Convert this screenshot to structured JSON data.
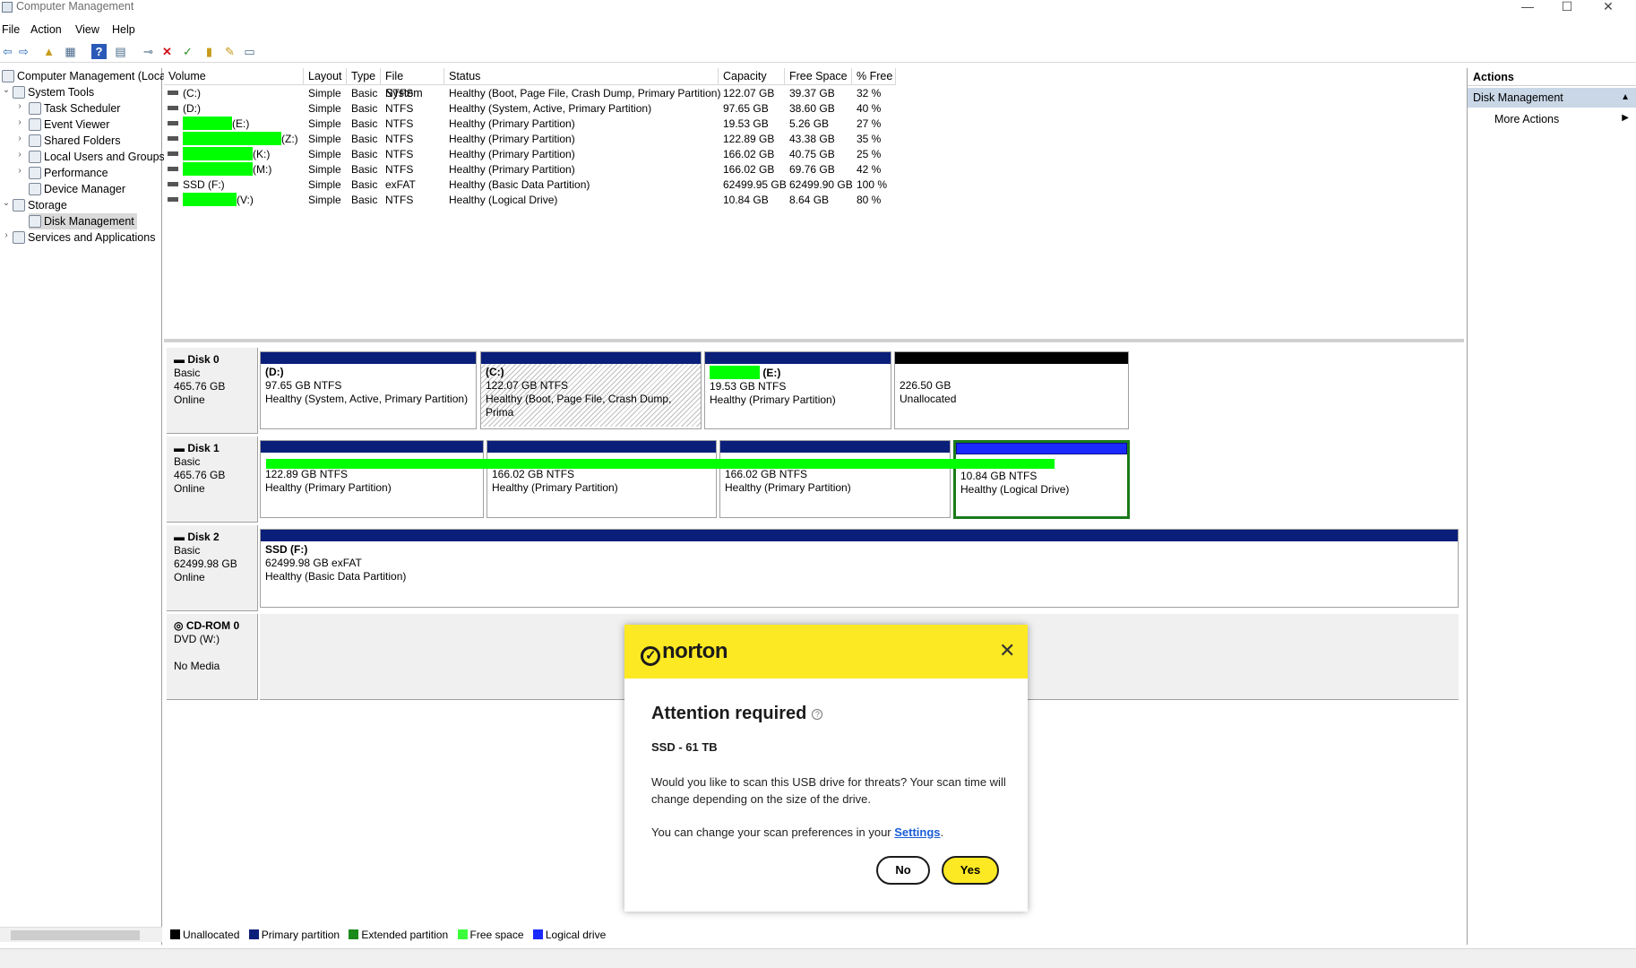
{
  "window": {
    "title": "Computer Management",
    "min": "—",
    "max": "☐",
    "close": "✕"
  },
  "menu": [
    "File",
    "Action",
    "View",
    "Help"
  ],
  "tree": {
    "root": "Computer Management (Local",
    "system_tools": "System Tools",
    "task_scheduler": "Task Scheduler",
    "event_viewer": "Event Viewer",
    "shared_folders": "Shared Folders",
    "local_users": "Local Users and Groups",
    "performance": "Performance",
    "device_manager": "Device Manager",
    "storage": "Storage",
    "disk_management": "Disk Management",
    "services": "Services and Applications"
  },
  "columns": [
    "Volume",
    "Layout",
    "Type",
    "File System",
    "Status",
    "Capacity",
    "Free Space",
    "% Free"
  ],
  "volumes": [
    {
      "name": "(C:)",
      "layout": "Simple",
      "type": "Basic",
      "fs": "NTFS",
      "status": "Healthy (Boot, Page File, Crash Dump, Primary Partition)",
      "capacity": "122.07 GB",
      "free": "39.37 GB",
      "pct": "32 %"
    },
    {
      "name": "(D:)",
      "layout": "Simple",
      "type": "Basic",
      "fs": "NTFS",
      "status": "Healthy (System, Active, Primary Partition)",
      "capacity": "97.65 GB",
      "free": "38.60 GB",
      "pct": "40 %"
    },
    {
      "name": "(E:)",
      "layout": "Simple",
      "type": "Basic",
      "fs": "NTFS",
      "status": "Healthy (Primary Partition)",
      "capacity": "19.53 GB",
      "free": "5.26 GB",
      "pct": "27 %"
    },
    {
      "name": "(Z:)",
      "layout": "Simple",
      "type": "Basic",
      "fs": "NTFS",
      "status": "Healthy (Primary Partition)",
      "capacity": "122.89 GB",
      "free": "43.38 GB",
      "pct": "35 %"
    },
    {
      "name": "(K:)",
      "layout": "Simple",
      "type": "Basic",
      "fs": "NTFS",
      "status": "Healthy (Primary Partition)",
      "capacity": "166.02 GB",
      "free": "40.75 GB",
      "pct": "25 %"
    },
    {
      "name": "(M:)",
      "layout": "Simple",
      "type": "Basic",
      "fs": "NTFS",
      "status": "Healthy (Primary Partition)",
      "capacity": "166.02 GB",
      "free": "69.76 GB",
      "pct": "42 %"
    },
    {
      "name": "SSD (F:)",
      "layout": "Simple",
      "type": "Basic",
      "fs": "exFAT",
      "status": "Healthy (Basic Data Partition)",
      "capacity": "62499.95 GB",
      "free": "62499.90 GB",
      "pct": "100 %"
    },
    {
      "name": "(V:)",
      "layout": "Simple",
      "type": "Basic",
      "fs": "NTFS",
      "status": "Healthy (Logical Drive)",
      "capacity": "10.84 GB",
      "free": "8.64 GB",
      "pct": "80 %"
    }
  ],
  "disks": {
    "d0": {
      "name": "Disk 0",
      "type": "Basic",
      "size": "465.76 GB",
      "state": "Online"
    },
    "d1": {
      "name": "Disk 1",
      "type": "Basic",
      "size": "465.76 GB",
      "state": "Online"
    },
    "d2": {
      "name": "Disk 2",
      "type": "Basic",
      "size": "62499.98 GB",
      "state": "Online"
    },
    "cd": {
      "name": "CD-ROM 0",
      "type": "DVD (W:)",
      "state": "No Media"
    }
  },
  "parts": {
    "d0p1": {
      "label": "(D:)",
      "size": "97.65 GB NTFS",
      "status": "Healthy (System, Active, Primary Partition)"
    },
    "d0p2": {
      "label": "(C:)",
      "size": "122.07 GB NTFS",
      "status": "Healthy (Boot, Page File, Crash Dump, Prima"
    },
    "d0p3": {
      "label": "(E:)",
      "size": "19.53 GB NTFS",
      "status": "Healthy (Primary Partition)"
    },
    "d0p4": {
      "size": "226.50 GB",
      "status": "Unallocated"
    },
    "d1p1": {
      "size": "122.89 GB NTFS",
      "status": "Healthy (Primary Partition)"
    },
    "d1p2": {
      "size": "166.02 GB NTFS",
      "status": "Healthy (Primary Partition)"
    },
    "d1p3": {
      "size": "166.02 GB NTFS",
      "status": "Healthy (Primary Partition)"
    },
    "d1p4": {
      "size": "10.84 GB NTFS",
      "status": "Healthy (Logical Drive)"
    },
    "d2p1": {
      "label": "SSD  (F:)",
      "size": "62499.98 GB exFAT",
      "status": "Healthy (Basic Data Partition)"
    }
  },
  "legend": [
    {
      "label": "Unallocated",
      "color": "#000000"
    },
    {
      "label": "Primary partition",
      "color": "#0a1f7a"
    },
    {
      "label": "Extended partition",
      "color": "#1a8a1a"
    },
    {
      "label": "Free space",
      "color": "#3cff3c"
    },
    {
      "label": "Logical drive",
      "color": "#1a2aff"
    }
  ],
  "actions": {
    "header": "Actions",
    "section": "Disk Management",
    "more": "More Actions"
  },
  "norton": {
    "brand": "norton",
    "title": "Attention required",
    "subtitle": "SSD - 61 TB",
    "body": "Would you like to scan this USB drive for threats? Your scan time will change depending on the size of the drive.",
    "pref_prefix": "You can change your scan preferences in your ",
    "settings_link": "Settings",
    "pref_suffix": ".",
    "no": "No",
    "yes": "Yes",
    "accent": "#fde923"
  }
}
